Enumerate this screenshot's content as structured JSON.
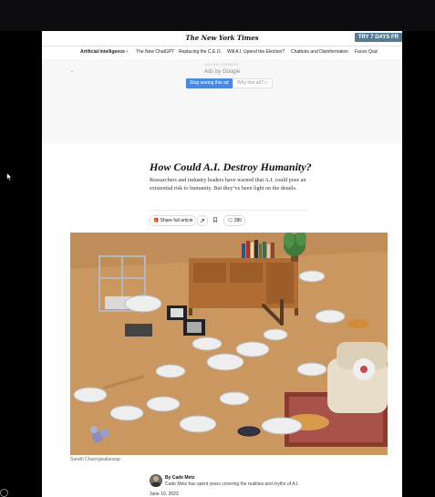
{
  "masthead": {
    "logo": "The New York Times",
    "try_label": "TRY 7 DAYS FR"
  },
  "nav": {
    "items": [
      "Artificial Intelligence ›",
      "The New ChatGPT",
      "Replacing the C.E.O.",
      "Will A.I. Upend the Election?",
      "Chatbots and Disinformation",
      "Faces Quiz"
    ]
  },
  "ad": {
    "label": "ADVERTISEMENT",
    "ads_by": "Ads by Google",
    "stop_label": "Stop seeing this ad",
    "why_label": "Why this ad? ▷"
  },
  "article": {
    "headline": "How Could A.I. Destroy Humanity?",
    "summary": "Researchers and industry leaders have warned that A.I. could pose an existential risk to humanity. But they’ve been light on the details.",
    "share_label": "Share full article",
    "comment_count": "280",
    "caption": "Sarath Chuengsatiansup",
    "byline_name": "By Cade Metz",
    "byline_bio": "Cade Metz has spent years covering the realities and myths of A.I.",
    "date": "June 10, 2023"
  },
  "colors": {
    "try_button": "#567b95",
    "stop_button": "#4a89dc",
    "floor": "#c79862"
  },
  "icons": [
    "gift-icon",
    "share-icon",
    "bookmark-icon",
    "comment-icon",
    "arrow-cursor-icon"
  ]
}
